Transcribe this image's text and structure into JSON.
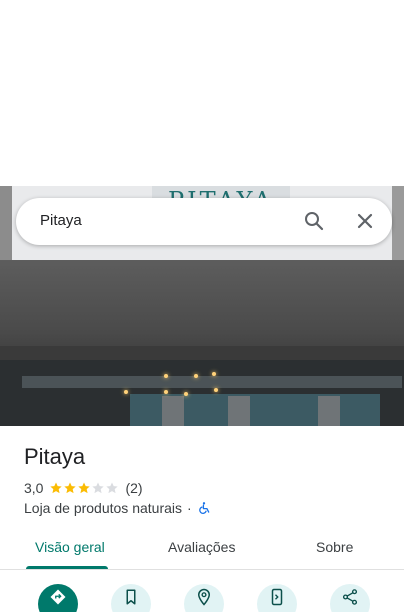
{
  "search": {
    "query": "Pitaya"
  },
  "photo": {
    "sign_text": "PITAYA"
  },
  "place": {
    "name": "Pitaya",
    "rating": "3,0",
    "stars_filled": 3,
    "stars_total": 5,
    "review_count": "(2)",
    "category": "Loja de produtos naturais",
    "separator": "·"
  },
  "tabs": [
    {
      "label": "Visão geral",
      "active": true
    },
    {
      "label": "Avaliações",
      "active": false
    },
    {
      "label": "Sobre",
      "active": false
    }
  ],
  "actions": [
    {
      "icon": "directions-icon",
      "primary": true
    },
    {
      "icon": "bookmark-icon",
      "primary": false
    },
    {
      "icon": "nearby-icon",
      "primary": false
    },
    {
      "icon": "send-to-phone-icon",
      "primary": false
    },
    {
      "icon": "share-icon",
      "primary": false
    }
  ],
  "colors": {
    "accent": "#00796b",
    "star": "#fbbc04",
    "star_empty": "#dadce0",
    "action_bg": "#e1f3f4",
    "wheelchair": "#1a73e8"
  }
}
